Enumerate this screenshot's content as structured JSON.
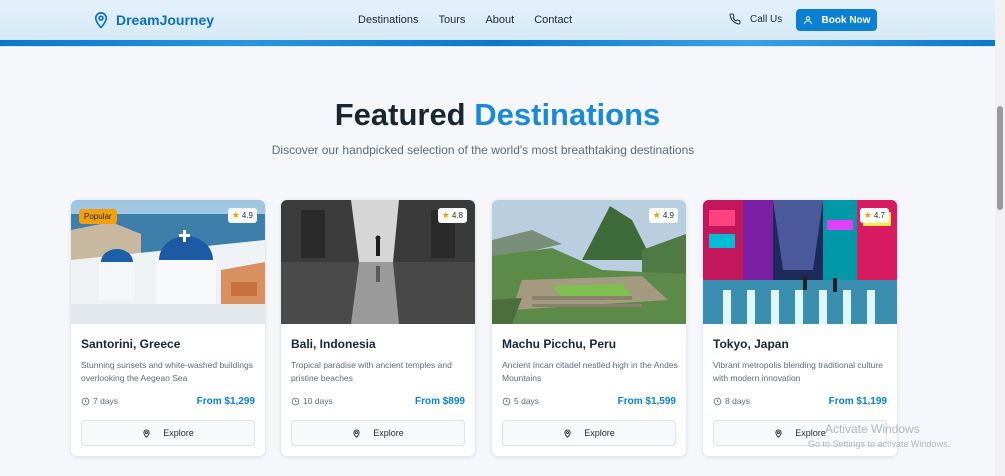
{
  "header": {
    "brand": "DreamJourney",
    "nav": [
      "Destinations",
      "Tours",
      "About",
      "Contact"
    ],
    "call_label": "Call Us",
    "book_label": "Book Now"
  },
  "hero": {
    "title_main": "Featured",
    "title_accent": "Destinations",
    "subtitle": "Discover our handpicked selection of the world's most breathtaking destinations"
  },
  "cards": [
    {
      "badge": "Popular",
      "rating": "4.9",
      "name": "Santorini, Greece",
      "description": "Stunning sunsets and white-washed buildings overlooking the Aegean Sea",
      "duration": "7 days",
      "price": "From $1,299",
      "action": "Explore"
    },
    {
      "badge": "",
      "rating": "4.8",
      "name": "Bali, Indonesia",
      "description": "Tropical paradise with ancient temples and pristine beaches",
      "duration": "10 days",
      "price": "From $899",
      "action": "Explore"
    },
    {
      "badge": "",
      "rating": "4.9",
      "name": "Machu Picchu, Peru",
      "description": "Ancient Incan citadel nestled high in the Andes Mountains",
      "duration": "5 days",
      "price": "From $1,599",
      "action": "Explore"
    },
    {
      "badge": "",
      "rating": "4.7",
      "name": "Tokyo, Japan",
      "description": "Vibrant metropolis blending traditional culture with modern innovation",
      "duration": "8 days",
      "price": "From $1,199",
      "action": "Explore"
    }
  ],
  "watermark": {
    "line1": "Activate Windows",
    "line2": "Go to Settings to activate Windows."
  },
  "colors": {
    "accent": "#1a8ad8",
    "button": "#0b80d3",
    "badge": "#f59e0b",
    "star": "#f59e0b"
  }
}
